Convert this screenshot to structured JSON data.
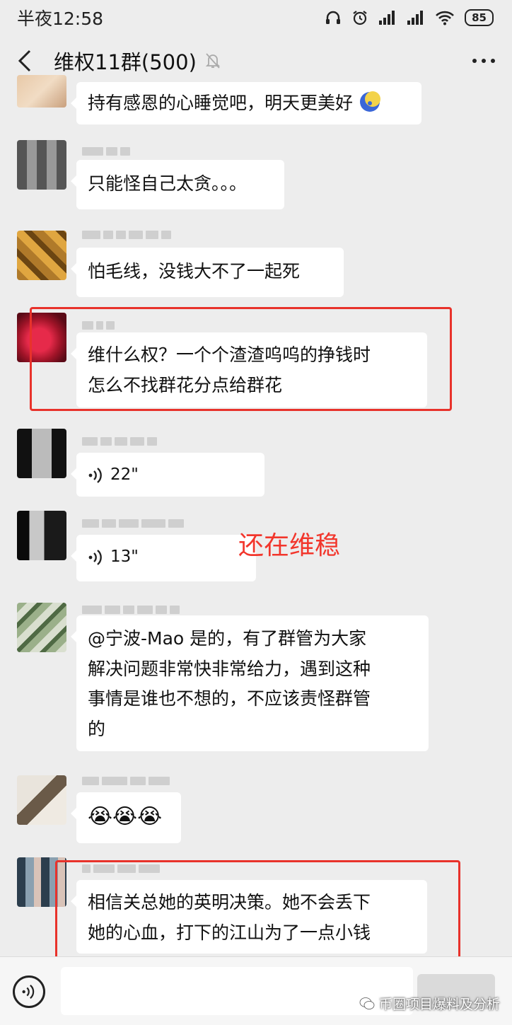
{
  "status_bar": {
    "time": "半夜12:58",
    "battery": "85"
  },
  "title_bar": {
    "title": "维权11群(500)"
  },
  "messages": [
    {
      "text": "持有感恩的心睡觉吧，明天更美好"
    },
    {
      "text": "只能怪自己太贪。。。"
    },
    {
      "text": "怕毛线，没钱大不了一起死"
    },
    {
      "line1": "维什么权？一个个渣渣呜呜的挣钱时",
      "line2": "怎么不找群花分点给群花"
    },
    {
      "duration": "22\""
    },
    {
      "duration": "13\""
    },
    {
      "line1": "@宁波-Mao  是的，有了群管为大家",
      "line2": "解决问题非常快非常给力，遇到这种",
      "line3": "事情是谁也不想的，不应该责怪群管",
      "line4": "的"
    },
    {
      "emoji": "😭😭😭"
    },
    {
      "line1": "相信关总她的英明决策。她不会丢下",
      "line2": "她的心血，打下的江山为了一点小钱"
    }
  ],
  "annotation": "还在维稳",
  "watermark": "币圈项目爆料及分析",
  "colors": {
    "highlight": "#e8322b",
    "annotation": "#f2362c",
    "background": "#ededed"
  }
}
